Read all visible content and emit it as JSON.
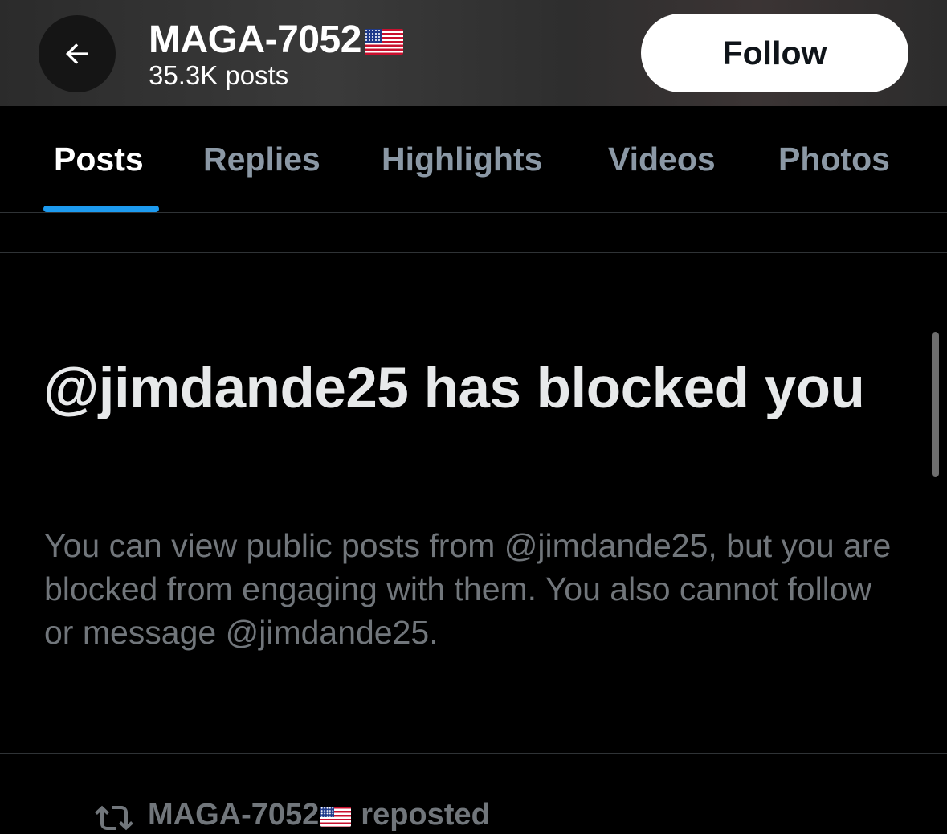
{
  "header": {
    "profile_name": "MAGA-7052",
    "flag_icon": "us-flag-icon",
    "post_count": "35.3K posts",
    "follow_label": "Follow"
  },
  "tabs": [
    {
      "label": "Posts",
      "active": true
    },
    {
      "label": "Replies",
      "active": false
    },
    {
      "label": "Highlights",
      "active": false
    },
    {
      "label": "Videos",
      "active": false
    },
    {
      "label": "Photos",
      "active": false
    }
  ],
  "blocked_notice": {
    "title": "@jimdande25 has blocked you",
    "body": "You can view public posts from @jimdande25, but you are blocked from engaging with them. You also cannot follow or message @jimdande25."
  },
  "repost": {
    "user": "MAGA-7052",
    "suffix": "reposted",
    "icon": "repost-icon"
  },
  "colors": {
    "accent": "#1d9bf0",
    "background": "#000000",
    "muted_text": "#71767b",
    "inactive_tab": "#8b98a5"
  }
}
